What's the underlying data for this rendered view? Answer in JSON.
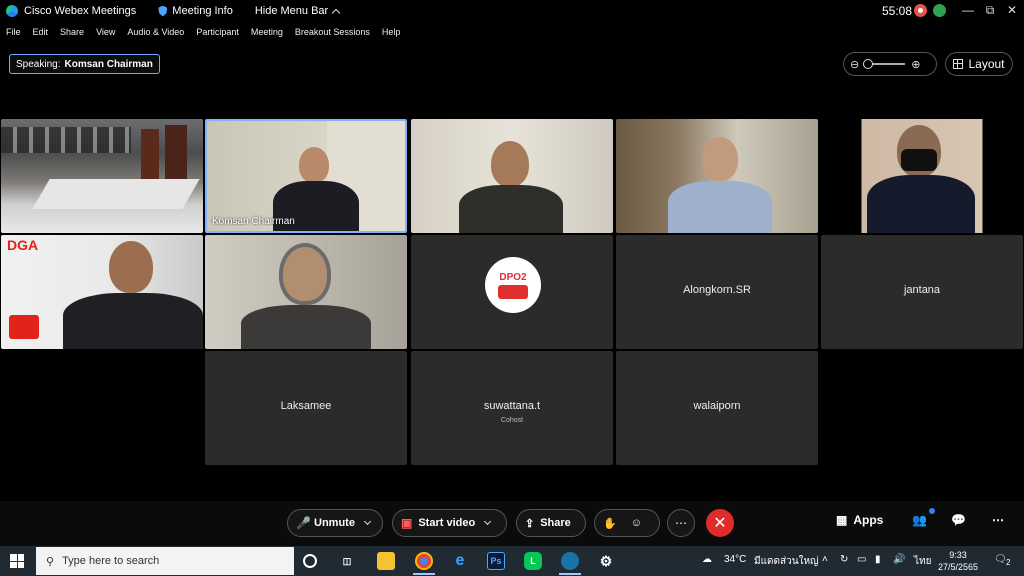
{
  "titlebar": {
    "app_name": "Cisco Webex Meetings",
    "meeting_info": "Meeting Info",
    "hide_menu_bar": "Hide Menu Bar",
    "timer": "55:08"
  },
  "menu": [
    "File",
    "Edit",
    "Share",
    "View",
    "Audio & Video",
    "Participant",
    "Meeting",
    "Breakout Sessions",
    "Help"
  ],
  "speaking": {
    "prefix": "Speaking:",
    "name": "Komsan Chairman"
  },
  "layout_label": "Layout",
  "tiles": [
    {
      "name": "",
      "type": "video"
    },
    {
      "name": "Komsan Chairman",
      "type": "video",
      "speaking": true
    },
    {
      "name": "",
      "type": "video"
    },
    {
      "name": "",
      "type": "video"
    },
    {
      "name": "",
      "type": "video"
    },
    {
      "name": "",
      "type": "video",
      "banner": "DGA"
    },
    {
      "name": "",
      "type": "video"
    },
    {
      "name": "",
      "type": "avatar",
      "avatar_text": "DPO2"
    },
    {
      "name": "Alongkorn.SR",
      "type": "name"
    },
    {
      "name": "jantana",
      "type": "name"
    },
    {
      "name": "Laksamee",
      "type": "name"
    },
    {
      "name": "suwattana.t",
      "type": "name",
      "sub": "Cohost"
    },
    {
      "name": "walaiporn",
      "type": "name"
    }
  ],
  "controls": {
    "unmute": "Unmute",
    "start_video": "Start video",
    "share": "Share",
    "apps": "Apps"
  },
  "taskbar": {
    "search_placeholder": "Type here to search",
    "weather": "34°C",
    "weather_desc": "มีแดดส่วนใหญ่",
    "lang": "ไทย",
    "time": "9:33",
    "date": "27/5/2565",
    "notifications": "2"
  },
  "colors": {
    "accent": "#7fb3ff",
    "end_call": "#e02b2b",
    "tile_bg": "#2b2b2b",
    "taskbar_bg": "#1f2a33"
  }
}
